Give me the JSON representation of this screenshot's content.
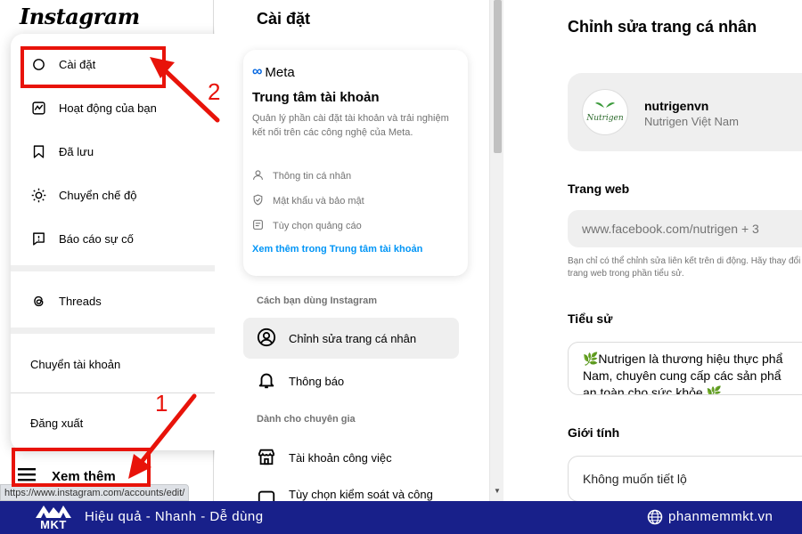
{
  "app": {
    "logo": "Instagram"
  },
  "menu": {
    "items": [
      {
        "label": "Cài đặt",
        "icon": "settings-gear-icon"
      },
      {
        "label": "Hoạt động của bạn",
        "icon": "activity-icon"
      },
      {
        "label": "Đã lưu",
        "icon": "bookmark-icon"
      },
      {
        "label": "Chuyển chế độ",
        "icon": "sun-icon"
      },
      {
        "label": "Báo cáo sự cố",
        "icon": "report-icon"
      }
    ],
    "threads": "Threads",
    "switch_account": "Chuyển tài khoản",
    "logout": "Đăng xuất"
  },
  "nav": {
    "more_label": "Xem thêm"
  },
  "settings": {
    "title": "Cài đặt",
    "meta": {
      "brand": "Meta",
      "title": "Trung tâm tài khoản",
      "description": "Quản lý phần cài đặt tài khoản và trải nghiệm kết nối trên các công nghệ của Meta.",
      "options": [
        "Thông tin cá nhân",
        "Mật khẩu và bảo mật",
        "Tùy chọn quảng cáo"
      ],
      "link": "Xem thêm trong Trung tâm tài khoản"
    },
    "section_how": "Cách bạn dùng Instagram",
    "items_how": [
      "Chỉnh sửa trang cá nhân",
      "Thông báo"
    ],
    "section_pro": "Dành cho chuyên gia",
    "items_pro": [
      "Tài khoản công việc",
      "Tùy chọn kiểm soát và công"
    ]
  },
  "edit_profile": {
    "title": "Chỉnh sửa trang cá nhân",
    "username": "nutrigenvn",
    "fullname": "Nutrigen Việt Nam",
    "avatar_text": "Nutrigen",
    "website_label": "Trang web",
    "website_value": "www.facebook.com/nutrigen + 3",
    "website_help": "Bạn chỉ có thể chỉnh sửa liên kết trên di động. Hãy thay đổi trang web trong phần tiểu sử.",
    "bio_label": "Tiểu sử",
    "bio_lines": [
      "🌿Nutrigen là thương hiệu thực phẩ",
      "Nam, chuyên cung cấp các sản phẩ",
      "an toàn cho sức khỏe 🌿"
    ],
    "gender_label": "Giới tính",
    "gender_value": "Không muốn tiết lộ"
  },
  "status_url": "https://www.instagram.com/accounts/edit/",
  "annotations": {
    "step1": "1",
    "step2": "2",
    "color": "#e8130a"
  },
  "footer": {
    "logo_text": "MKT",
    "tagline": "Hiệu quả - Nhanh - Dễ dùng",
    "site": "phanmemmkt.vn",
    "bg": "#18208a"
  }
}
